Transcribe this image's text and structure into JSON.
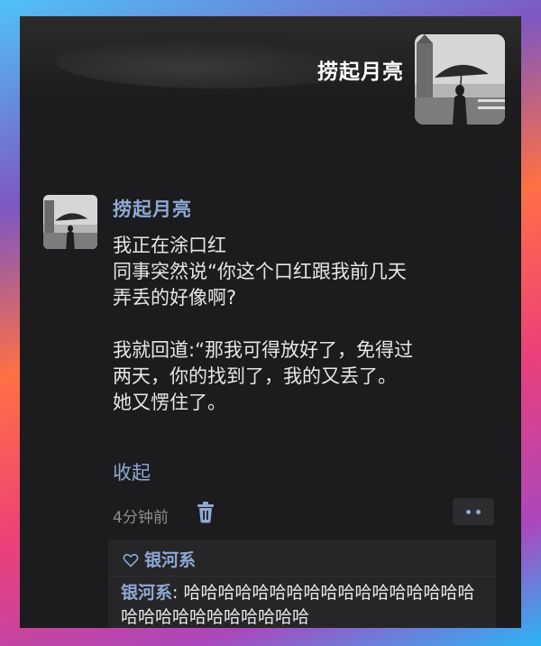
{
  "profile": {
    "name": "捞起月亮"
  },
  "post": {
    "username": "捞起月亮",
    "lines": [
      "我正在涂口红",
      "同事突然说“你这个口红跟我前几天",
      "弄丢的好像啊?",
      "",
      "我就回道:“那我可得放好了，免得过",
      "两天，你的找到了，我的又丢了。",
      "她又愣住了。"
    ],
    "collapse_label": "收起",
    "time": "4分钟前"
  },
  "icons": {
    "delete": "trash-icon",
    "more": "more-dots-icon",
    "like": "heart-icon"
  },
  "likes": {
    "names": "银河系"
  },
  "comments": [
    {
      "author": "银河系",
      "separator": ": ",
      "text": "哈哈哈哈哈哈哈哈哈哈哈哈哈哈哈哈哈哈哈哈哈哈哈哈哈哈哈哈"
    }
  ],
  "colors": {
    "link": "#8fa9d4",
    "background": "#1c1c1e",
    "text": "#e6e6e6"
  }
}
